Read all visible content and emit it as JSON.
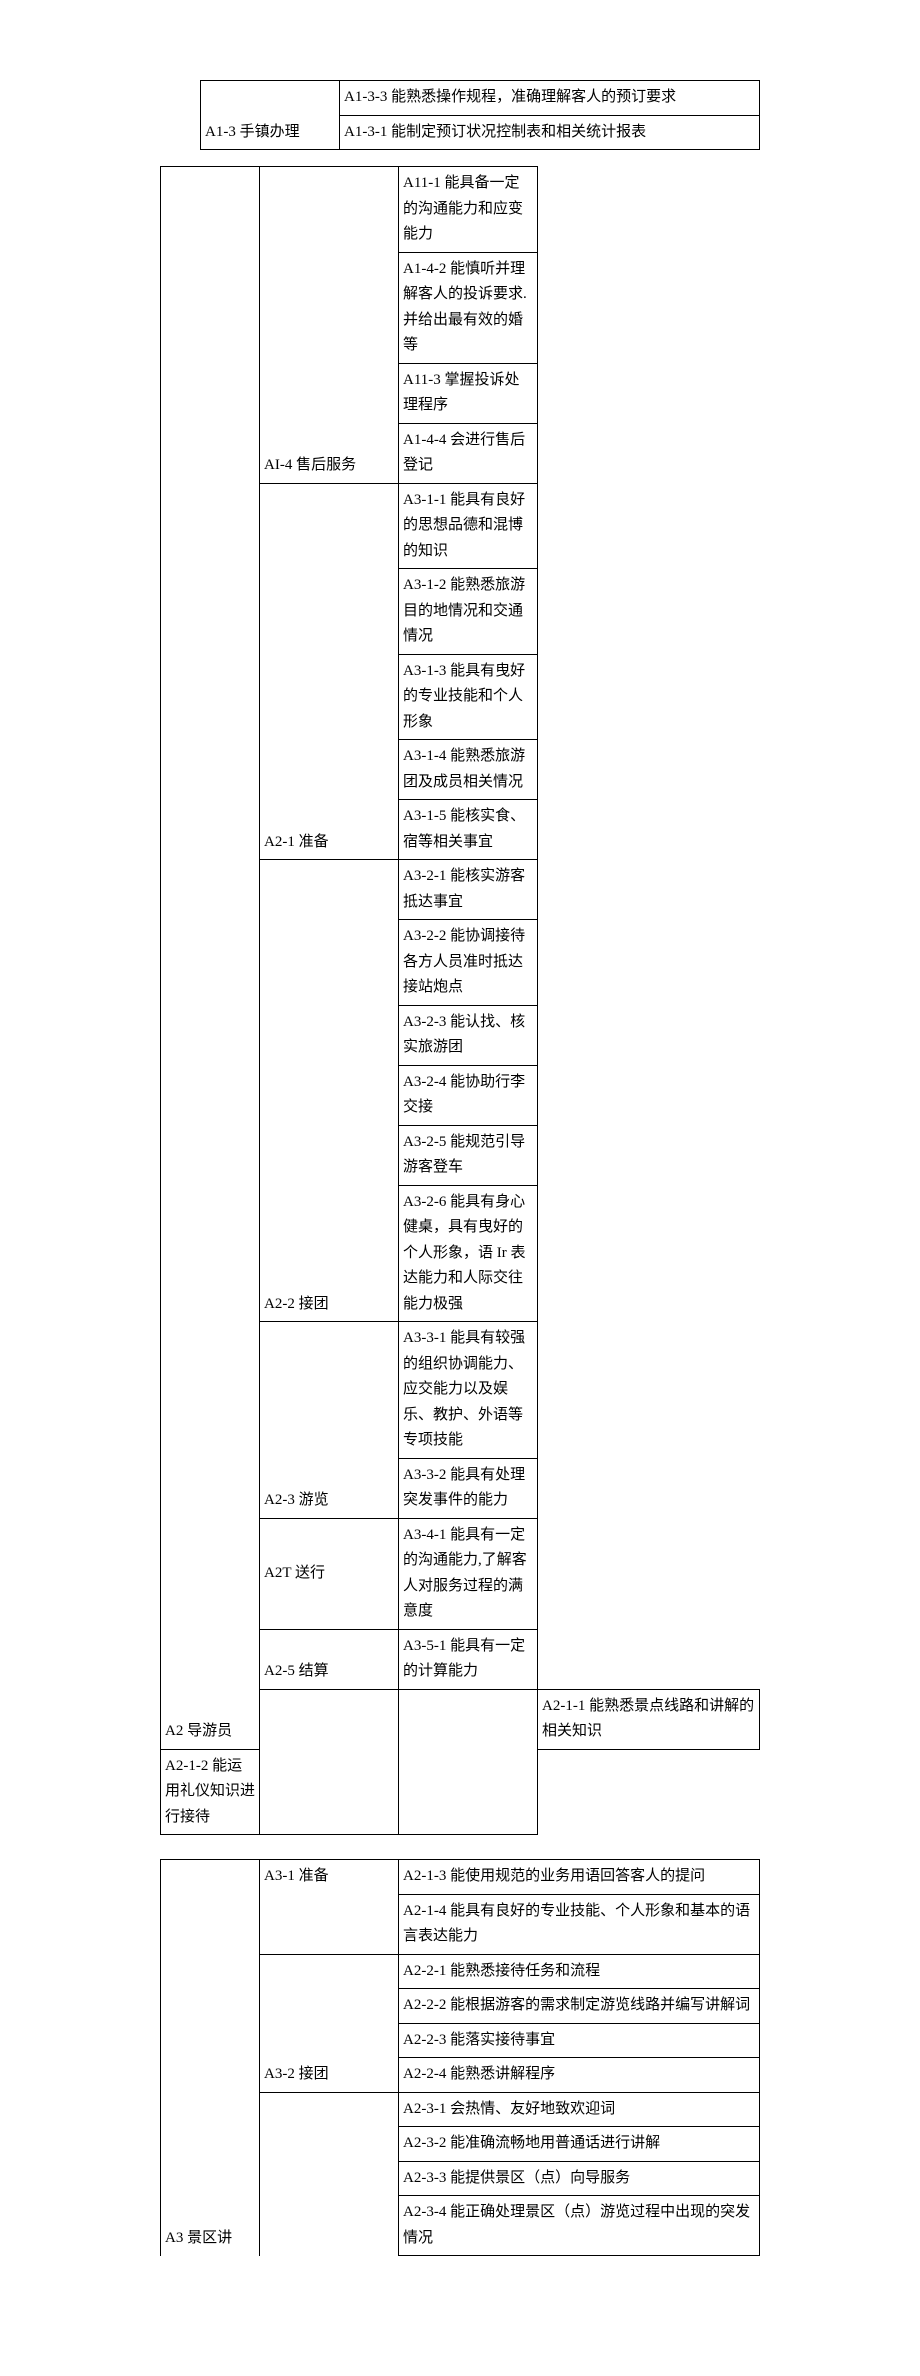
{
  "table1": {
    "col1": "A1-3 手镇办理",
    "rows": [
      "A1-3-3 能熟悉操作规程，准确理解客人的预订要求",
      "A1-3-1 能制定预订状况控制表和相关统计报表"
    ]
  },
  "table2": {
    "col1": "A2 导游员",
    "sections": [
      {
        "label": "AI-4 售后服务",
        "rows": [
          "A11-1 能具备一定的沟通能力和应变能力",
          "A1-4-2 能慎听并理解客人的投诉要求.并给出最有效的婚等",
          "A11-3 掌握投诉处理程序",
          "A1-4-4 会进行售后登记"
        ]
      },
      {
        "label": "A2-1 准备",
        "rows": [
          "A3-1-1 能具有良好的思想品德和混博的知识",
          "A3-1-2 能熟悉旅游目的地情况和交通情况",
          "A3-1-3 能具有曳好的专业技能和个人形象",
          "A3-1-4 能熟悉旅游团及成员相关情况",
          "A3-1-5 能核实食、宿等相关事宜"
        ]
      },
      {
        "label": "A2-2 接团",
        "rows": [
          "A3-2-1 能核实游客抵达事宜",
          "A3-2-2 能协调接待各方人员准时抵达接站炮点",
          "A3-2-3 能认找、核实旅游团",
          "A3-2-4 能协助行李交接",
          "A3-2-5 能规范引导游客登车",
          "A3-2-6 能具有身心健桌，具有曳好的个人形象，语 Ir 表达能力和人际交往能力极强"
        ]
      },
      {
        "label": "A2-3 游览",
        "rows": [
          "A3-3-1 能具有较强的组织协调能力、应交能力以及娱乐、教护、外语等专项技能",
          "A3-3-2 能具有处理突发事件的能力"
        ]
      },
      {
        "label": "A2T 送行",
        "rows": [
          "A3-4-1 能具有一定的沟通能力,了解客人对服务过程的满意度"
        ]
      },
      {
        "label": "A2-5 结算",
        "rows": [
          "A3-5-1 能具有一定的计算能力"
        ]
      },
      {
        "label": "",
        "rows": [
          "A2-1-1 能熟悉景点线路和讲解的相关知识",
          "A2-1-2 能运用礼仪知识进行接待"
        ]
      }
    ]
  },
  "table3": {
    "col1": "A3 景区讲",
    "sections": [
      {
        "label": "A3-1 准备",
        "rows": [
          "A2-1-3 能使用规范的业务用语回答客人的提问",
          "A2-1-4 能具有良好的专业技能、个人形象和基本的语言表达能力"
        ]
      },
      {
        "label": "A3-2 接团",
        "rows": [
          "A2-2-1 能熟悉接待任务和流程",
          "A2-2-2 能根据游客的需求制定游览线路并编写讲解词",
          "A2-2-3 能落实接待事宜",
          "A2-2-4 能熟悉讲解程序"
        ]
      },
      {
        "label": "",
        "rows": [
          "A2-3-1 会热情、友好地致欢迎词",
          "A2-3-2 能准确流畅地用普通话进行讲解",
          "A2-3-3 能提供景区（点）向导服务",
          "A2-3-4 能正确处理景区（点）游览过程中出现的突发情况"
        ]
      }
    ]
  }
}
